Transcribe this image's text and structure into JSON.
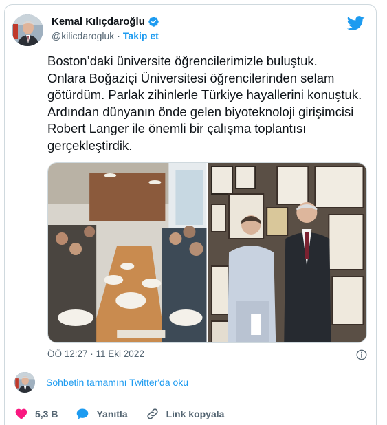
{
  "author": {
    "name": "Kemal Kılıçdaroğlu",
    "handle": "@kilicdarogluk",
    "separator": "·",
    "follow_label": "Takip et"
  },
  "tweet": {
    "text": "Boston’daki üniversite öğrencilerimizle buluştuk.\nOnlara Boğaziçi Üniversitesi öğrencilerinden selam götürdüm. Parlak zihinlerle Türkiye hayallerini konuştuk. Ardından dünyanın önde gelen biyoteknoloji girişimcisi Robert Langer ile önemli bir çalışma toplantısı gerçekleştirdik.",
    "time": "ÖÖ 12:27 · 11 Eki 2022"
  },
  "thread": {
    "link_label": "Sohbetin tamamını Twitter'da oku"
  },
  "actions": {
    "like_count": "5,3 B",
    "reply_label": "Yanıtla",
    "copy_link_label": "Link kopyala"
  },
  "colors": {
    "accent": "#1d9bf0",
    "like": "#f91880",
    "text": "#0f1419",
    "muted": "#536471"
  },
  "icons": {
    "verified": "verified-badge-icon",
    "logo": "twitter-bird-icon",
    "info": "info-icon",
    "like": "heart-icon",
    "reply": "speech-bubble-icon",
    "copy": "link-icon"
  }
}
